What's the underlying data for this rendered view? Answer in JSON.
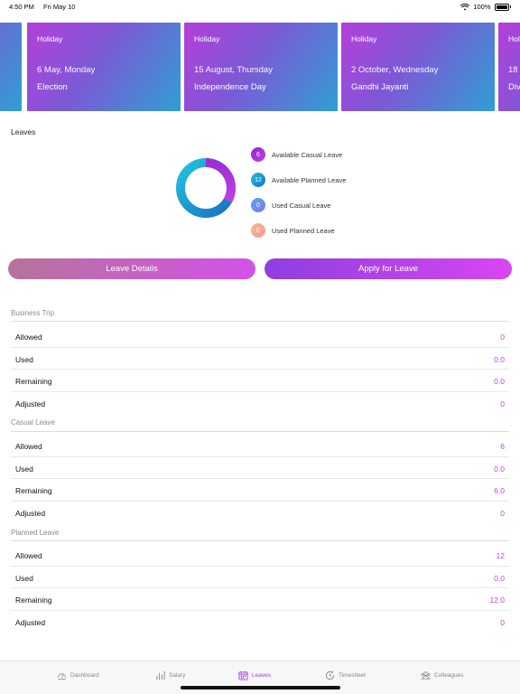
{
  "status_bar": {
    "time": "4:50 PM",
    "date": "Fri May 10",
    "battery": "100%"
  },
  "holidays": [
    {
      "type": "Holiday",
      "date": "6 May, Monday",
      "name": "Election"
    },
    {
      "type": "Holiday",
      "date": "15 August, Thursday",
      "name": "Independence Day"
    },
    {
      "type": "Holiday",
      "date": "2 October, Wednesday",
      "name": "Gandhi Jayanti"
    },
    {
      "type": "Hol",
      "date": "18",
      "name": "Div"
    }
  ],
  "leaves": {
    "title": "Leaves",
    "legend": [
      {
        "count": "6",
        "label": "Available Casual Leave",
        "color": "#a22ed6"
      },
      {
        "count": "12",
        "label": "Available Planned Leave",
        "color": "#1a8fd0"
      },
      {
        "count": "0",
        "label": "Used Casual Leave",
        "color": "#6f8df0"
      },
      {
        "count": "0",
        "label": "Used Planned Leave",
        "color": "#f5a48c"
      }
    ]
  },
  "buttons": {
    "details": "Leave Details",
    "apply": "Apply for Leave"
  },
  "groups": [
    {
      "title": "Business Trip",
      "rows": [
        {
          "label": "Allowed",
          "value": "0"
        },
        {
          "label": "Used",
          "value": "0.0"
        },
        {
          "label": "Remaining",
          "value": "0.0"
        },
        {
          "label": "Adjusted",
          "value": "0"
        }
      ]
    },
    {
      "title": "Casual Leave",
      "rows": [
        {
          "label": "Allowed",
          "value": "6"
        },
        {
          "label": "Used",
          "value": "0.0"
        },
        {
          "label": "Remaining",
          "value": "6.0"
        },
        {
          "label": "Adjusted",
          "value": "0"
        }
      ]
    },
    {
      "title": "Planned Leave",
      "rows": [
        {
          "label": "Allowed",
          "value": "12"
        },
        {
          "label": "Used",
          "value": "0.0"
        },
        {
          "label": "Remaining",
          "value": "12.0"
        },
        {
          "label": "Adjusted",
          "value": "0"
        }
      ]
    }
  ],
  "tabs": [
    {
      "label": "Dashboard",
      "icon": "dashboard-icon",
      "active": false
    },
    {
      "label": "Salary",
      "icon": "salary-icon",
      "active": false
    },
    {
      "label": "Leaves",
      "icon": "calendar-icon",
      "active": true
    },
    {
      "label": "Timesheet",
      "icon": "timesheet-icon",
      "active": false
    },
    {
      "label": "Colleagues",
      "icon": "colleagues-icon",
      "active": false
    }
  ],
  "colors": {
    "accent": "#a33be6",
    "value_text": "#b54be0"
  }
}
